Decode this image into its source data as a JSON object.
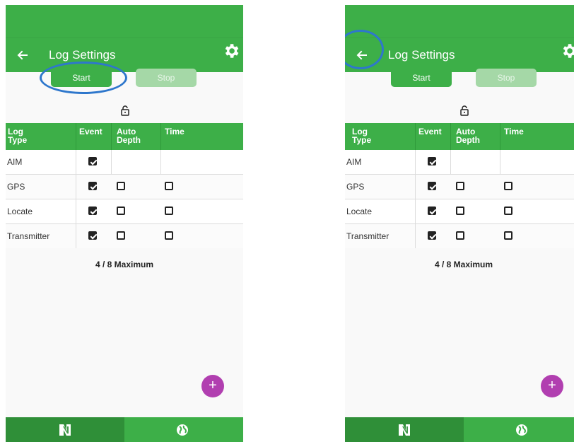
{
  "screens": [
    {
      "app_title": "Log Settings",
      "start_label": "Start",
      "stop_label": "Stop",
      "headers": {
        "log_type": "Log\nType",
        "event": "Event",
        "auto_depth": "Auto\nDepth",
        "time": "Time"
      },
      "rows": [
        {
          "label": "AIM",
          "event": true,
          "auto_depth": null,
          "time": null
        },
        {
          "label": "GPS",
          "event": true,
          "auto_depth": false,
          "time": false
        },
        {
          "label": "Locate",
          "event": true,
          "auto_depth": false,
          "time": false
        },
        {
          "label": "Transmitter",
          "event": true,
          "auto_depth": false,
          "time": false
        }
      ],
      "count_text": "4 / 8 Maximum",
      "fab_label": "+",
      "highlight": "start-button"
    },
    {
      "app_title": "Log Settings",
      "start_label": "Start",
      "stop_label": "Stop",
      "headers": {
        "log_type": "Log\nType",
        "event": "Event",
        "auto_depth": "Auto\nDepth",
        "time": "Time"
      },
      "rows": [
        {
          "label": "AIM",
          "event": true,
          "auto_depth": null,
          "time": null
        },
        {
          "label": "GPS",
          "event": true,
          "auto_depth": false,
          "time": false
        },
        {
          "label": "Locate",
          "event": true,
          "auto_depth": false,
          "time": false
        },
        {
          "label": "Transmitter",
          "event": true,
          "auto_depth": false,
          "time": false
        }
      ],
      "count_text": "4 / 8 Maximum",
      "fab_label": "+",
      "highlight": "back-button"
    }
  ],
  "colors": {
    "primary": "#3daf48",
    "primary_dark": "#2f8f38",
    "disabled": "#a5d8a7",
    "fab": "#b13fb0",
    "highlight": "#2e77cc"
  },
  "icons": [
    "back-arrow-icon",
    "gear-icon",
    "lock-icon",
    "checkbox-icon",
    "plus-icon",
    "app-logo-icon",
    "globe-icon"
  ]
}
